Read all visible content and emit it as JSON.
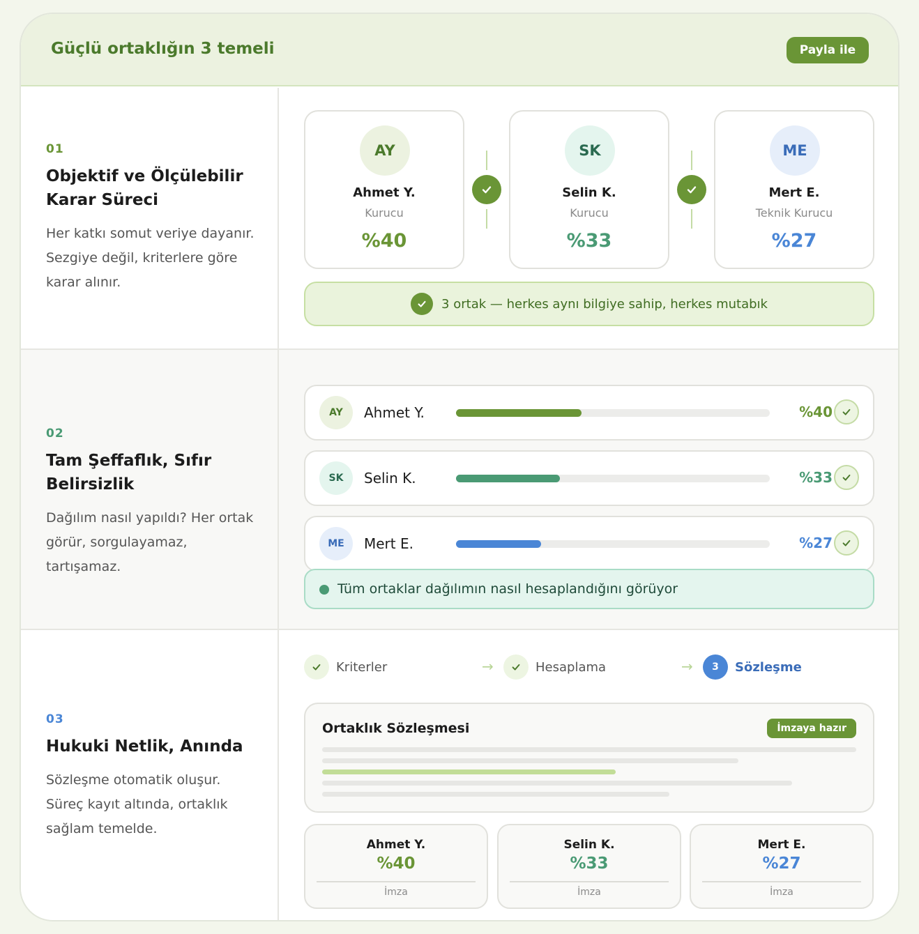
{
  "header": {
    "title": "Güçlü ortaklığın 3 temeli",
    "share_label": "Payla ile"
  },
  "colors": {
    "green": "#6a9536",
    "teal": "#4a9a74",
    "blue": "#4a86d6",
    "header_bg": "#ecf2e0"
  },
  "sections": [
    {
      "num": "01",
      "title": "Objektif ve Ölçülebilir Karar Süreci",
      "desc": "Her katkı somut veriye dayanır. Sezgiye değil, kriterlere göre karar alınır."
    },
    {
      "num": "02",
      "title": "Tam Şeffaflık, Sıfır Belirsizlik",
      "desc": "Dağılım nasıl yapıldı? Her ortak görür, sorgulayamaz, tartışamaz."
    },
    {
      "num": "03",
      "title": "Hukuki Netlik, Anında",
      "desc": "Sözleşme otomatik oluşur. Süreç kayıt altında, ortaklık sağlam temelde."
    }
  ],
  "partners": [
    {
      "initials": "AY",
      "name": "Ahmet Y.",
      "role": "Kurucu",
      "pct": "%40",
      "share": 40
    },
    {
      "initials": "SK",
      "name": "Selin K.",
      "role": "Kurucu",
      "pct": "%33",
      "share": 33
    },
    {
      "initials": "ME",
      "name": "Mert E.",
      "role": "Teknik Kurucu",
      "pct": "%27",
      "share": 27
    }
  ],
  "consensus_text": "3 ortak — herkes aynı bilgiye sahip, herkes mutabık",
  "transparency_text": "Tüm ortaklar dağılımın nasıl hesaplandığını görüyor",
  "steps": [
    {
      "label": "Kriterler",
      "icon": "check-icon"
    },
    {
      "label": "Hesaplama",
      "icon": "check-icon"
    },
    {
      "label": "Sözleşme",
      "number": "3"
    }
  ],
  "contract": {
    "title": "Ortaklık Sözleşmesi",
    "badge": "İmzaya hazır"
  },
  "signature_label": "İmza"
}
